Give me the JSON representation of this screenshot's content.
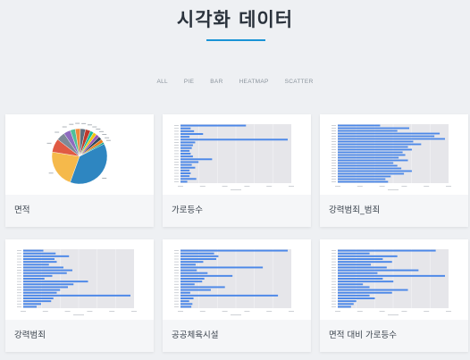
{
  "header": {
    "title": "시각화 데이터"
  },
  "filters": [
    "ALL",
    "PIE",
    "BAR",
    "HEATMAP",
    "SCATTER"
  ],
  "cards": [
    {
      "label": "면적",
      "kind": "pie"
    },
    {
      "label": "가로등수",
      "kind": "bar"
    },
    {
      "label": "강력범죄_범죄",
      "kind": "bar"
    },
    {
      "label": "강력범죄",
      "kind": "bar"
    },
    {
      "label": "공공체육시설",
      "kind": "bar"
    },
    {
      "label": "면적 대비 가로등수",
      "kind": "bar"
    }
  ],
  "colors": {
    "accent": "#1a93d6",
    "bar": "#4c88e8",
    "plot_bg": "#e6e6ea"
  },
  "chart_data": [
    {
      "type": "pie",
      "values": [
        38,
        22,
        8,
        5,
        4,
        3,
        3,
        3,
        3,
        2,
        2,
        2,
        2,
        2,
        1
      ]
    },
    {
      "type": "bar",
      "values": [
        58,
        9,
        12,
        20,
        8,
        95,
        13,
        11,
        10,
        8,
        9,
        11,
        28,
        16,
        10,
        13,
        8,
        9,
        8,
        14,
        6
      ]
    },
    {
      "type": "bar",
      "values": [
        32,
        54,
        45,
        77,
        73,
        81,
        57,
        63,
        53,
        56,
        49,
        51,
        46,
        53,
        42,
        45,
        48,
        56,
        50,
        40,
        36,
        38
      ]
    },
    {
      "type": "bar",
      "values": [
        18,
        29,
        41,
        28,
        30,
        23,
        36,
        44,
        39,
        26,
        19,
        58,
        45,
        40,
        33,
        30,
        96,
        27,
        25,
        16,
        12
      ]
    },
    {
      "type": "bar",
      "values": [
        99,
        31,
        35,
        33,
        21,
        14,
        76,
        15,
        25,
        48,
        22,
        20,
        13,
        41,
        28,
        9,
        90,
        12,
        8,
        11,
        10
      ]
    },
    {
      "type": "bar",
      "values": [
        74,
        24,
        45,
        34,
        41,
        25,
        37,
        61,
        30,
        81,
        34,
        42,
        19,
        24,
        53,
        41,
        24,
        28,
        14,
        12,
        10
      ]
    }
  ]
}
